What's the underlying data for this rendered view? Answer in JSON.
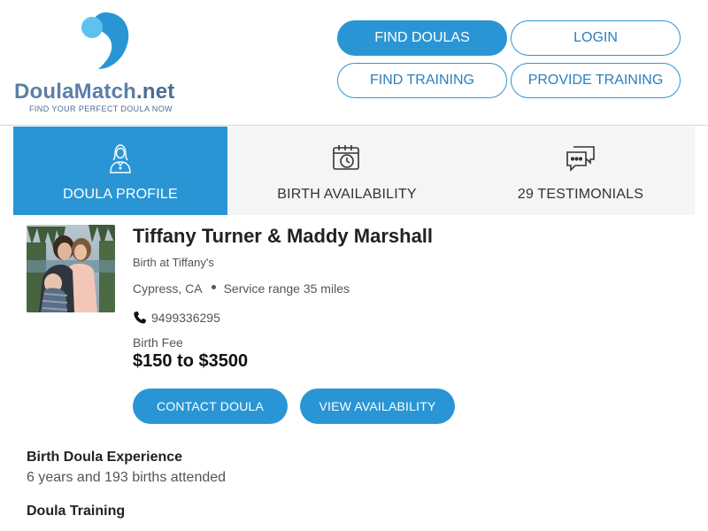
{
  "logo": {
    "name_part1": "Doula",
    "name_part2": "Match",
    "name_part3": ".net",
    "tagline": "FIND YOUR PERFECT DOULA NOW"
  },
  "nav": {
    "find_doulas": "FIND DOULAS",
    "login": "LOGIN",
    "find_training": "FIND TRAINING",
    "provide_training": "PROVIDE TRAINING"
  },
  "tabs": [
    {
      "label": "DOULA PROFILE",
      "icon": "doula-person-icon",
      "active": true
    },
    {
      "label": "BIRTH AVAILABILITY",
      "icon": "calendar-clock-icon",
      "active": false
    },
    {
      "label": "29 TESTIMONIALS",
      "icon": "chat-bubbles-icon",
      "active": false
    }
  ],
  "profile": {
    "name": "Tiffany Turner & Maddy Marshall",
    "business": "Birth at Tiffany's",
    "location": "Cypress, CA",
    "service_range": "Service range 35 miles",
    "phone": "9499336295",
    "fee_label": "Birth Fee",
    "fee_value": "$150 to $3500",
    "contact_button": "CONTACT DOULA",
    "availability_button": "VIEW AVAILABILITY"
  },
  "sections": {
    "experience_title": "Birth Doula Experience",
    "experience_text": "6 years and 193 births attended",
    "training_title": "Doula Training"
  },
  "colors": {
    "accent": "#2a95d4",
    "logo_blue": "#2a95d4",
    "text_muted": "#555555"
  }
}
